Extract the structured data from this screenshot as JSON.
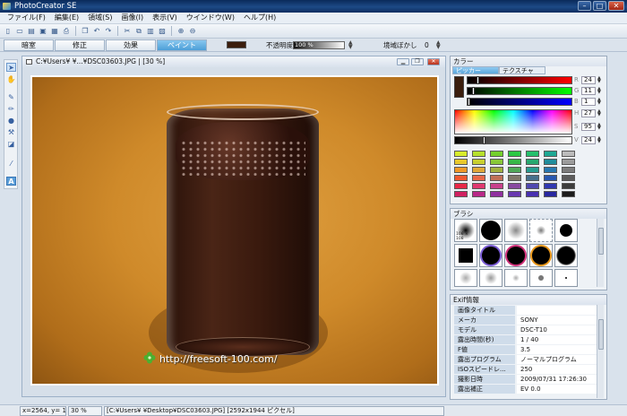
{
  "app": {
    "title": "PhotoCreator SE"
  },
  "menu": [
    "ファイル(F)",
    "編集(E)",
    "領域(S)",
    "画像(I)",
    "表示(V)",
    "ウインドウ(W)",
    "ヘルプ(H)"
  ],
  "modes": {
    "tabs": [
      "暗室",
      "修正",
      "効果",
      "ペイント"
    ],
    "active": "ペイント"
  },
  "paint_options": {
    "opacity_label": "不透明度",
    "opacity_value": "100 %",
    "blur_label": "境域ぼかし",
    "blur_value": "0",
    "current_color": "#3b1e0d"
  },
  "document": {
    "title": "C:¥Users¥         ¥...¥DSC03603.JPG |  [30 %]",
    "watermark": "http://freesoft-100.com/"
  },
  "color_panel": {
    "title": "カラー",
    "tabs": [
      "ピッカー",
      "テクスチャ"
    ],
    "active_tab": "ピッカー",
    "channels": [
      {
        "label": "R",
        "value": "24"
      },
      {
        "label": "G",
        "value": "11"
      },
      {
        "label": "B",
        "value": "1"
      },
      {
        "label": "H",
        "value": "27"
      },
      {
        "label": "S",
        "value": "95"
      },
      {
        "label": "V",
        "value": "24"
      }
    ]
  },
  "brush_panel": {
    "title": "ブラシ",
    "first_brush_label": "108 × 108"
  },
  "exif_panel": {
    "title": "Exif情報",
    "rows": [
      {
        "key": "画像タイトル",
        "value": ""
      },
      {
        "key": "メーカ",
        "value": "SONY"
      },
      {
        "key": "モデル",
        "value": "DSC-T10"
      },
      {
        "key": "露出時間(秒)",
        "value": "1 / 40"
      },
      {
        "key": "F値",
        "value": "3.5"
      },
      {
        "key": "露出プログラム",
        "value": "ノーマルプログラム"
      },
      {
        "key": "ISOスピードレ...",
        "value": "250"
      },
      {
        "key": "撮影日時",
        "value": "2009/07/31 17:26:30"
      },
      {
        "key": "露出補正",
        "value": "EV 0.0"
      }
    ]
  },
  "status": {
    "coords": "x=2564, y= 157",
    "zoom": "30 %",
    "file": "[C:¥Users¥            ¥Desktop¥DSC03603.JPG] [2592x1944 ピクセル]"
  }
}
